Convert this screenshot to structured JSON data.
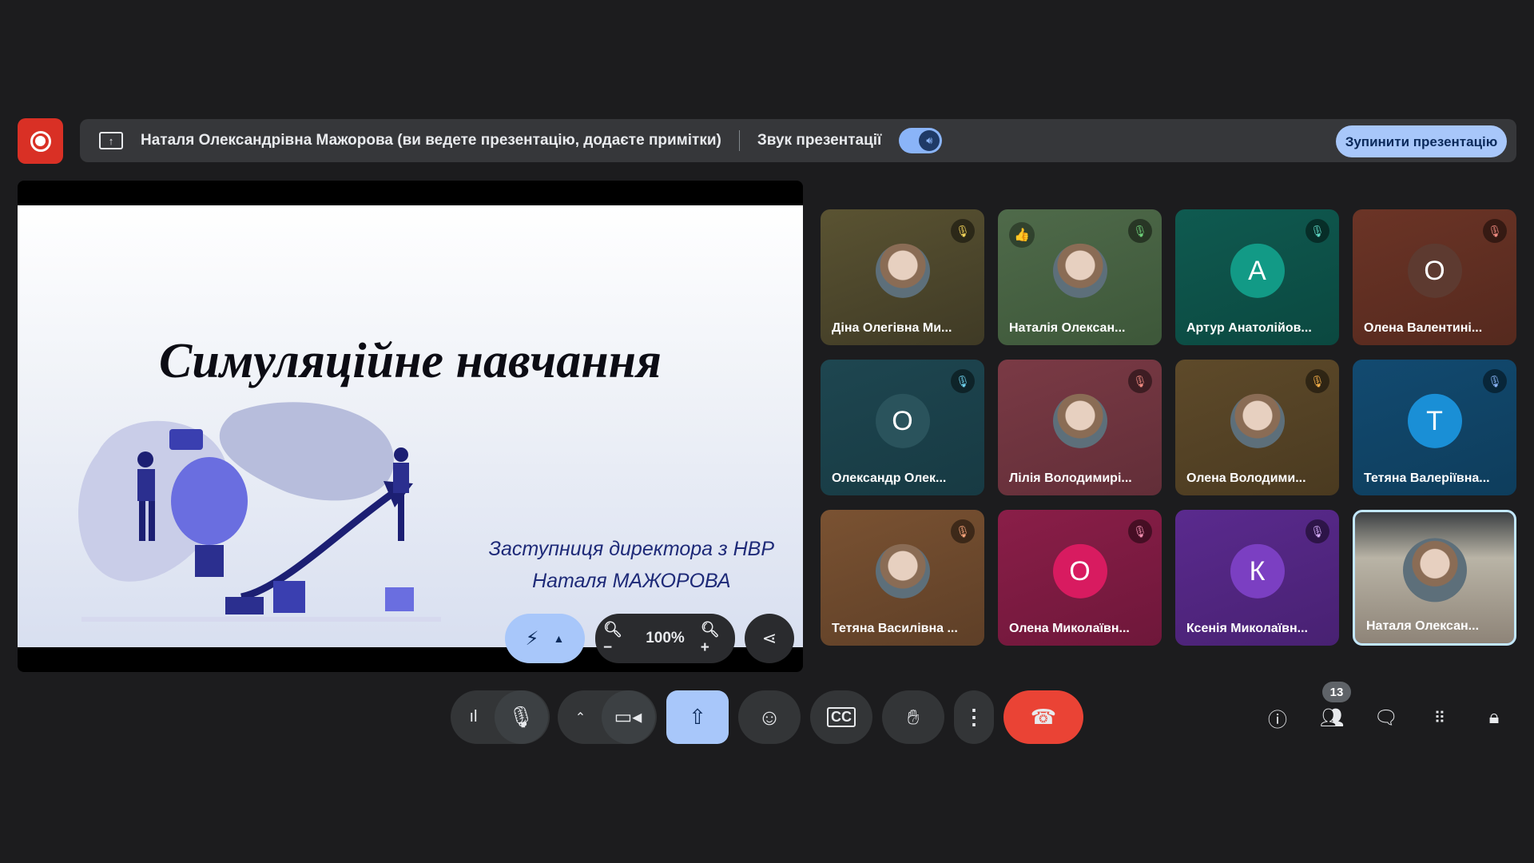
{
  "banner": {
    "presenter_text": "Наталя Олександрівна Мажорова (ви ведете презентацію, додаєте примітки)",
    "sound_label": "Звук презентації",
    "stop_button": "Зупинити презентацію"
  },
  "slide": {
    "title": "Симуляційне навчання",
    "author_line1": "Заступниця директора з НВР",
    "author_line2": "Наталя МАЖОРОВА"
  },
  "slide_controls": {
    "zoom_level": "100%"
  },
  "participants": [
    {
      "name": "Діна Олегівна Ми...",
      "avatar": "",
      "muted": true
    },
    {
      "name": "Наталія Олексан...",
      "avatar": "",
      "muted": true,
      "reaction": "👍"
    },
    {
      "name": "Артур Анатолійов...",
      "avatar": "А",
      "muted": true
    },
    {
      "name": "Олена Валентині...",
      "avatar": "О",
      "muted": true
    },
    {
      "name": "Олександр Олек...",
      "avatar": "О",
      "muted": true
    },
    {
      "name": "Лілія Володимирі...",
      "avatar": "",
      "muted": true
    },
    {
      "name": "Олена Володими...",
      "avatar": "",
      "muted": true
    },
    {
      "name": "Тетяна Валеріївна...",
      "avatar": "Т",
      "muted": true
    },
    {
      "name": "Тетяна Василівна ...",
      "avatar": "",
      "muted": true
    },
    {
      "name": "Олена Миколаївн...",
      "avatar": "О",
      "muted": true
    },
    {
      "name": "Ксенія Миколаївн...",
      "avatar": "К",
      "muted": true
    },
    {
      "name": "Наталя Олексан...",
      "avatar": "",
      "muted": false
    }
  ],
  "participant_count": "13",
  "colors": {
    "record": "#d93025",
    "accent": "#a8c7fa",
    "end_call": "#ea4335"
  }
}
